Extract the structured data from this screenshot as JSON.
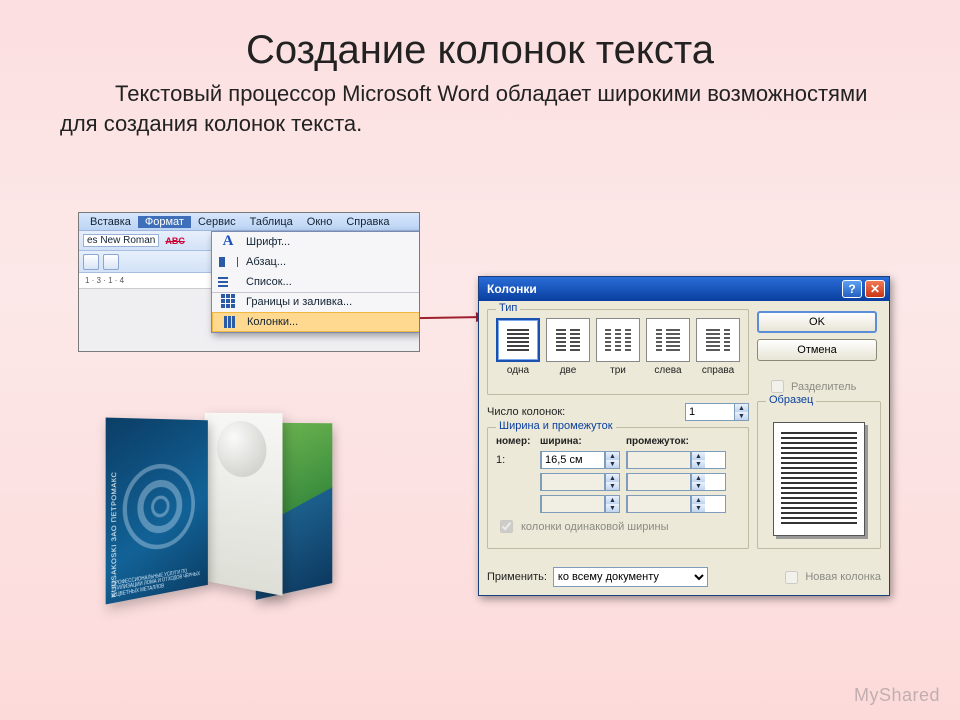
{
  "slide": {
    "title": "Создание колонок текста",
    "body": "Текстовый процессор Microsoft Word обладает широкими возможностями для создания колонок текста."
  },
  "watermark": "MyShared",
  "menubar": {
    "items": [
      "Вставка",
      "Формат",
      "Сервис",
      "Таблица",
      "Окно",
      "Справка"
    ],
    "open_index": 1,
    "font_box": "es New Roman",
    "abc": "ABC",
    "ruler": "1 · 3 · 1 · 4"
  },
  "dropdown": [
    {
      "icon": "bigA",
      "label": "Шрифт..."
    },
    {
      "icon": "para",
      "label": "Абзац..."
    },
    {
      "icon": "bul",
      "label": "Список..."
    },
    {
      "icon": "grid",
      "label": "Границы и заливка..."
    },
    {
      "icon": "cols",
      "label": "Колонки...",
      "selected": true
    }
  ],
  "brochure": {
    "side_text": "KUUSAKOSKI  ЗАО ПЕТРОМАКС",
    "bottom_text": "ПРОФЕССИОНАЛЬНЫЕ УСЛУГИ ПО УТИЛИЗАЦИИ ЛОМА И ОТХОДОВ ЧЁРНЫХ И ЦВЕТНЫХ МЕТАЛЛОВ"
  },
  "dialog": {
    "title": "Колонки",
    "group_type": "Тип",
    "types": [
      {
        "label": "одна",
        "selected": true
      },
      {
        "label": "две"
      },
      {
        "label": "три"
      },
      {
        "label": "слева"
      },
      {
        "label": "справа"
      }
    ],
    "ok": "OK",
    "cancel": "Отмена",
    "num_label": "Число колонок:",
    "num_value": "1",
    "divider_label": "Разделитель",
    "group_width": "Ширина и промежуток",
    "headers": {
      "n": "номер:",
      "w": "ширина:",
      "g": "промежуток:"
    },
    "row1": {
      "n": "1:",
      "w": "16,5 см",
      "g": ""
    },
    "equal_cols": "колонки одинаковой ширины",
    "group_preview": "Образец",
    "apply_label": "Применить:",
    "apply_value": "ко всему документу",
    "new_col": "Новая колонка"
  }
}
